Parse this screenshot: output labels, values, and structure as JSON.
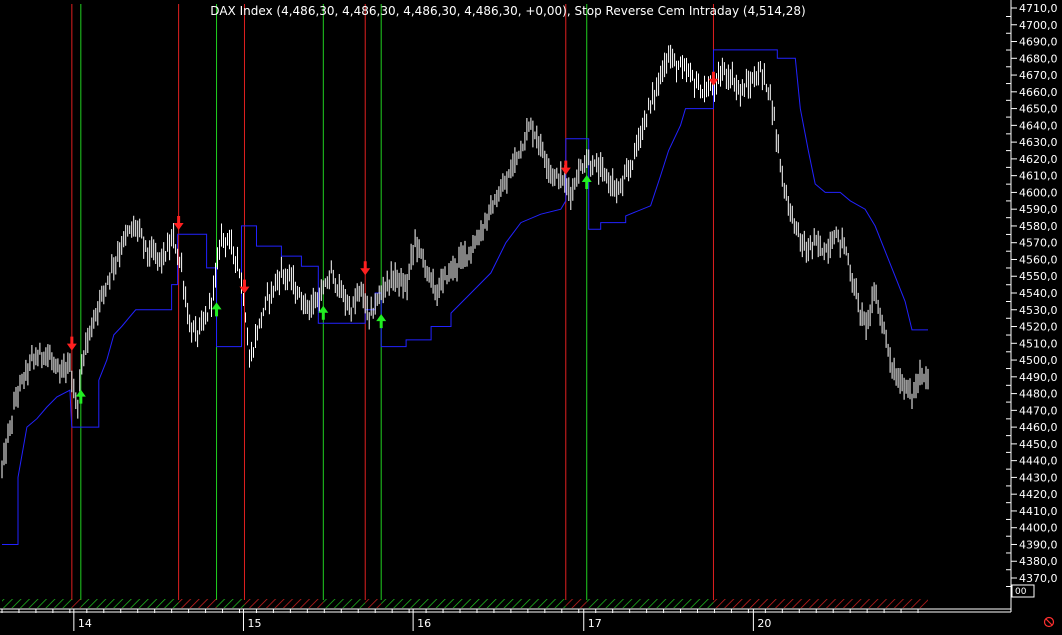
{
  "chart_data": {
    "type": "line",
    "title": "DAX Index (4,486,30, 4,486,30, 4,486,30, 4,486,30, +0,00), Stop Reverse Cem Intraday (4,514,28)",
    "y_ticks": [
      "4710,0",
      "4700,0",
      "4690,0",
      "4680,0",
      "4670,0",
      "4660,0",
      "4650,0",
      "4640,0",
      "4630,0",
      "4620,0",
      "4610,0",
      "4600,0",
      "4590,0",
      "4580,0",
      "4570,0",
      "4560,0",
      "4550,0",
      "4540,0",
      "4530,0",
      "4520,0",
      "4510,0",
      "4500,0",
      "4490,0",
      "4480,0",
      "4470,0",
      "4460,0",
      "4450,0",
      "4440,0",
      "4430,0",
      "4420,0",
      "4410,0",
      "4400,0",
      "4390,0",
      "4380,0",
      "4370,0"
    ],
    "ylim": [
      4363,
      4712
    ],
    "x_ticks": [
      {
        "label": "14",
        "bar": 72
      },
      {
        "label": "15",
        "bar": 242
      },
      {
        "label": "16",
        "bar": 412
      },
      {
        "label": "17",
        "bar": 583
      },
      {
        "label": "20",
        "bar": 753
      }
    ],
    "bar_count": 930,
    "price_series": {
      "name": "DAX Index",
      "color": "#ffffff",
      "points": [
        [
          0,
          4435
        ],
        [
          15,
          4480
        ],
        [
          30,
          4500
        ],
        [
          45,
          4505
        ],
        [
          58,
          4490
        ],
        [
          68,
          4498
        ],
        [
          75,
          4470
        ],
        [
          82,
          4505
        ],
        [
          95,
          4530
        ],
        [
          110,
          4555
        ],
        [
          125,
          4575
        ],
        [
          135,
          4580
        ],
        [
          145,
          4565
        ],
        [
          160,
          4560
        ],
        [
          172,
          4572
        ],
        [
          180,
          4555
        ],
        [
          188,
          4520
        ],
        [
          195,
          4515
        ],
        [
          205,
          4525
        ],
        [
          213,
          4545
        ],
        [
          220,
          4575
        ],
        [
          228,
          4570
        ],
        [
          236,
          4560
        ],
        [
          243,
          4535
        ],
        [
          248,
          4498
        ],
        [
          255,
          4515
        ],
        [
          265,
          4535
        ],
        [
          280,
          4552
        ],
        [
          290,
          4548
        ],
        [
          300,
          4535
        ],
        [
          310,
          4532
        ],
        [
          322,
          4540
        ],
        [
          330,
          4552
        ],
        [
          340,
          4540
        ],
        [
          350,
          4530
        ],
        [
          360,
          4542
        ],
        [
          368,
          4525
        ],
        [
          376,
          4535
        ],
        [
          384,
          4545
        ],
        [
          395,
          4550
        ],
        [
          405,
          4542
        ],
        [
          414,
          4572
        ],
        [
          425,
          4555
        ],
        [
          435,
          4540
        ],
        [
          445,
          4550
        ],
        [
          460,
          4560
        ],
        [
          475,
          4570
        ],
        [
          490,
          4590
        ],
        [
          505,
          4605
        ],
        [
          518,
          4625
        ],
        [
          530,
          4640
        ],
        [
          540,
          4628
        ],
        [
          552,
          4610
        ],
        [
          562,
          4608
        ],
        [
          570,
          4600
        ],
        [
          578,
          4612
        ],
        [
          585,
          4620
        ],
        [
          595,
          4615
        ],
        [
          605,
          4610
        ],
        [
          618,
          4600
        ],
        [
          630,
          4615
        ],
        [
          642,
          4640
        ],
        [
          655,
          4660
        ],
        [
          667,
          4682
        ],
        [
          678,
          4675
        ],
        [
          690,
          4670
        ],
        [
          702,
          4660
        ],
        [
          714,
          4662
        ],
        [
          722,
          4672
        ],
        [
          730,
          4670
        ],
        [
          740,
          4660
        ],
        [
          750,
          4665
        ],
        [
          760,
          4672
        ],
        [
          770,
          4660
        ],
        [
          777,
          4630
        ],
        [
          785,
          4600
        ],
        [
          795,
          4580
        ],
        [
          805,
          4565
        ],
        [
          815,
          4570
        ],
        [
          825,
          4565
        ],
        [
          835,
          4575
        ],
        [
          845,
          4568
        ],
        [
          855,
          4540
        ],
        [
          865,
          4520
        ],
        [
          875,
          4540
        ],
        [
          885,
          4515
        ],
        [
          895,
          4490
        ],
        [
          905,
          4485
        ],
        [
          912,
          4478
        ],
        [
          920,
          4490
        ],
        [
          928,
          4487
        ]
      ]
    },
    "stop_series": {
      "name": "Stop Reverse Cem Intraday",
      "color": "#2222ff",
      "points": [
        [
          0,
          4390
        ],
        [
          16,
          4390
        ],
        [
          16,
          4430
        ],
        [
          25,
          4460
        ],
        [
          35,
          4465
        ],
        [
          45,
          4472
        ],
        [
          55,
          4478
        ],
        [
          68,
          4482
        ],
        [
          70,
          4460
        ],
        [
          97,
          4460
        ],
        [
          97,
          4488
        ],
        [
          105,
          4500
        ],
        [
          112,
          4515
        ],
        [
          120,
          4520
        ],
        [
          127,
          4525
        ],
        [
          134,
          4530
        ],
        [
          170,
          4530
        ],
        [
          170,
          4545
        ],
        [
          176,
          4545
        ],
        [
          176,
          4575
        ],
        [
          205,
          4575
        ],
        [
          205,
          4555
        ],
        [
          215,
          4555
        ],
        [
          215,
          4508
        ],
        [
          240,
          4508
        ],
        [
          240,
          4580
        ],
        [
          255,
          4580
        ],
        [
          255,
          4568
        ],
        [
          280,
          4568
        ],
        [
          280,
          4562
        ],
        [
          300,
          4562
        ],
        [
          300,
          4556
        ],
        [
          317,
          4556
        ],
        [
          317,
          4522
        ],
        [
          364,
          4522
        ],
        [
          364,
          4530
        ],
        [
          374,
          4530
        ],
        [
          374,
          4540
        ],
        [
          380,
          4540
        ],
        [
          380,
          4508
        ],
        [
          405,
          4508
        ],
        [
          405,
          4512
        ],
        [
          430,
          4512
        ],
        [
          430,
          4520
        ],
        [
          450,
          4520
        ],
        [
          450,
          4528
        ],
        [
          470,
          4540
        ],
        [
          490,
          4552
        ],
        [
          505,
          4570
        ],
        [
          520,
          4582
        ],
        [
          540,
          4587
        ],
        [
          560,
          4590
        ],
        [
          565,
          4595
        ],
        [
          565,
          4632
        ],
        [
          588,
          4632
        ],
        [
          588,
          4578
        ],
        [
          600,
          4578
        ],
        [
          600,
          4582
        ],
        [
          625,
          4582
        ],
        [
          625,
          4586
        ],
        [
          650,
          4592
        ],
        [
          660,
          4610
        ],
        [
          668,
          4625
        ],
        [
          680,
          4640
        ],
        [
          685,
          4650
        ],
        [
          713,
          4650
        ],
        [
          713,
          4685
        ],
        [
          777,
          4685
        ],
        [
          777,
          4680
        ],
        [
          795,
          4680
        ],
        [
          800,
          4650
        ],
        [
          808,
          4625
        ],
        [
          815,
          4605
        ],
        [
          825,
          4600
        ],
        [
          840,
          4600
        ],
        [
          850,
          4595
        ],
        [
          865,
          4590
        ],
        [
          875,
          4580
        ],
        [
          885,
          4565
        ],
        [
          895,
          4550
        ],
        [
          905,
          4535
        ],
        [
          912,
          4518
        ],
        [
          928,
          4518
        ]
      ]
    },
    "sell_signals": [
      {
        "bar": 70,
        "price": 4508,
        "color": "#ff2020"
      },
      {
        "bar": 177,
        "price": 4580,
        "color": "#ff2020"
      },
      {
        "bar": 243,
        "price": 4542,
        "color": "#ff2020"
      },
      {
        "bar": 364,
        "price": 4553,
        "color": "#ff2020"
      },
      {
        "bar": 565,
        "price": 4613,
        "color": "#ff2020"
      },
      {
        "bar": 713,
        "price": 4666,
        "color": "#ff2020"
      }
    ],
    "buy_signals": [
      {
        "bar": 79,
        "price": 4480,
        "color": "#22ee22"
      },
      {
        "bar": 215,
        "price": 4532,
        "color": "#22ee22"
      },
      {
        "bar": 322,
        "price": 4530,
        "color": "#22ee22"
      },
      {
        "bar": 380,
        "price": 4525,
        "color": "#22ee22"
      },
      {
        "bar": 586,
        "price": 4608,
        "color": "#22ee22"
      }
    ],
    "red_vlines": [
      70,
      177,
      243,
      364,
      565,
      713
    ],
    "green_vlines": [
      79,
      215,
      322,
      380,
      586
    ],
    "grid": false,
    "background": "#000000"
  },
  "legend_corner_text": "00"
}
